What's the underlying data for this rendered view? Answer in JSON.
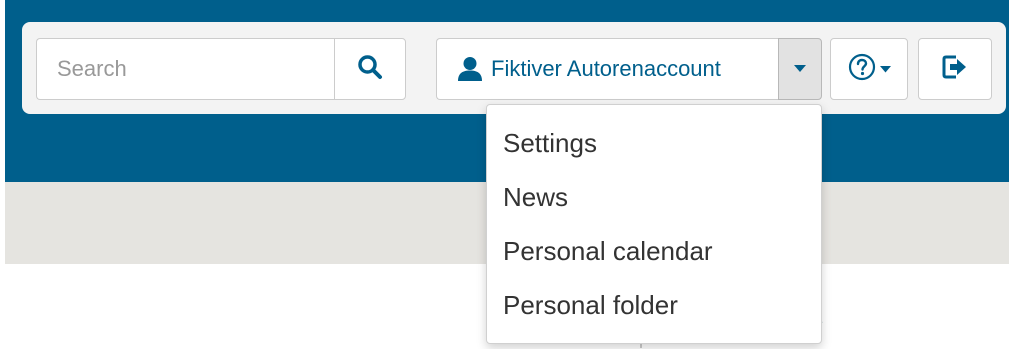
{
  "search": {
    "placeholder": "Search",
    "icon": "search-icon"
  },
  "user_menu": {
    "name": "Fiktiver Autorenaccount",
    "icon": "user-icon",
    "caret_icon": "caret-down-icon",
    "items": [
      {
        "label": "Settings"
      },
      {
        "label": "News"
      },
      {
        "label": "Personal calendar"
      },
      {
        "label": "Personal folder"
      }
    ]
  },
  "help": {
    "icon": "question-circle-icon"
  },
  "logout": {
    "icon": "sign-out-icon"
  },
  "colors": {
    "header_blue": "#005f8c",
    "grey_band": "#e5e4e0",
    "toolbar_bg": "#f3f3f3"
  }
}
